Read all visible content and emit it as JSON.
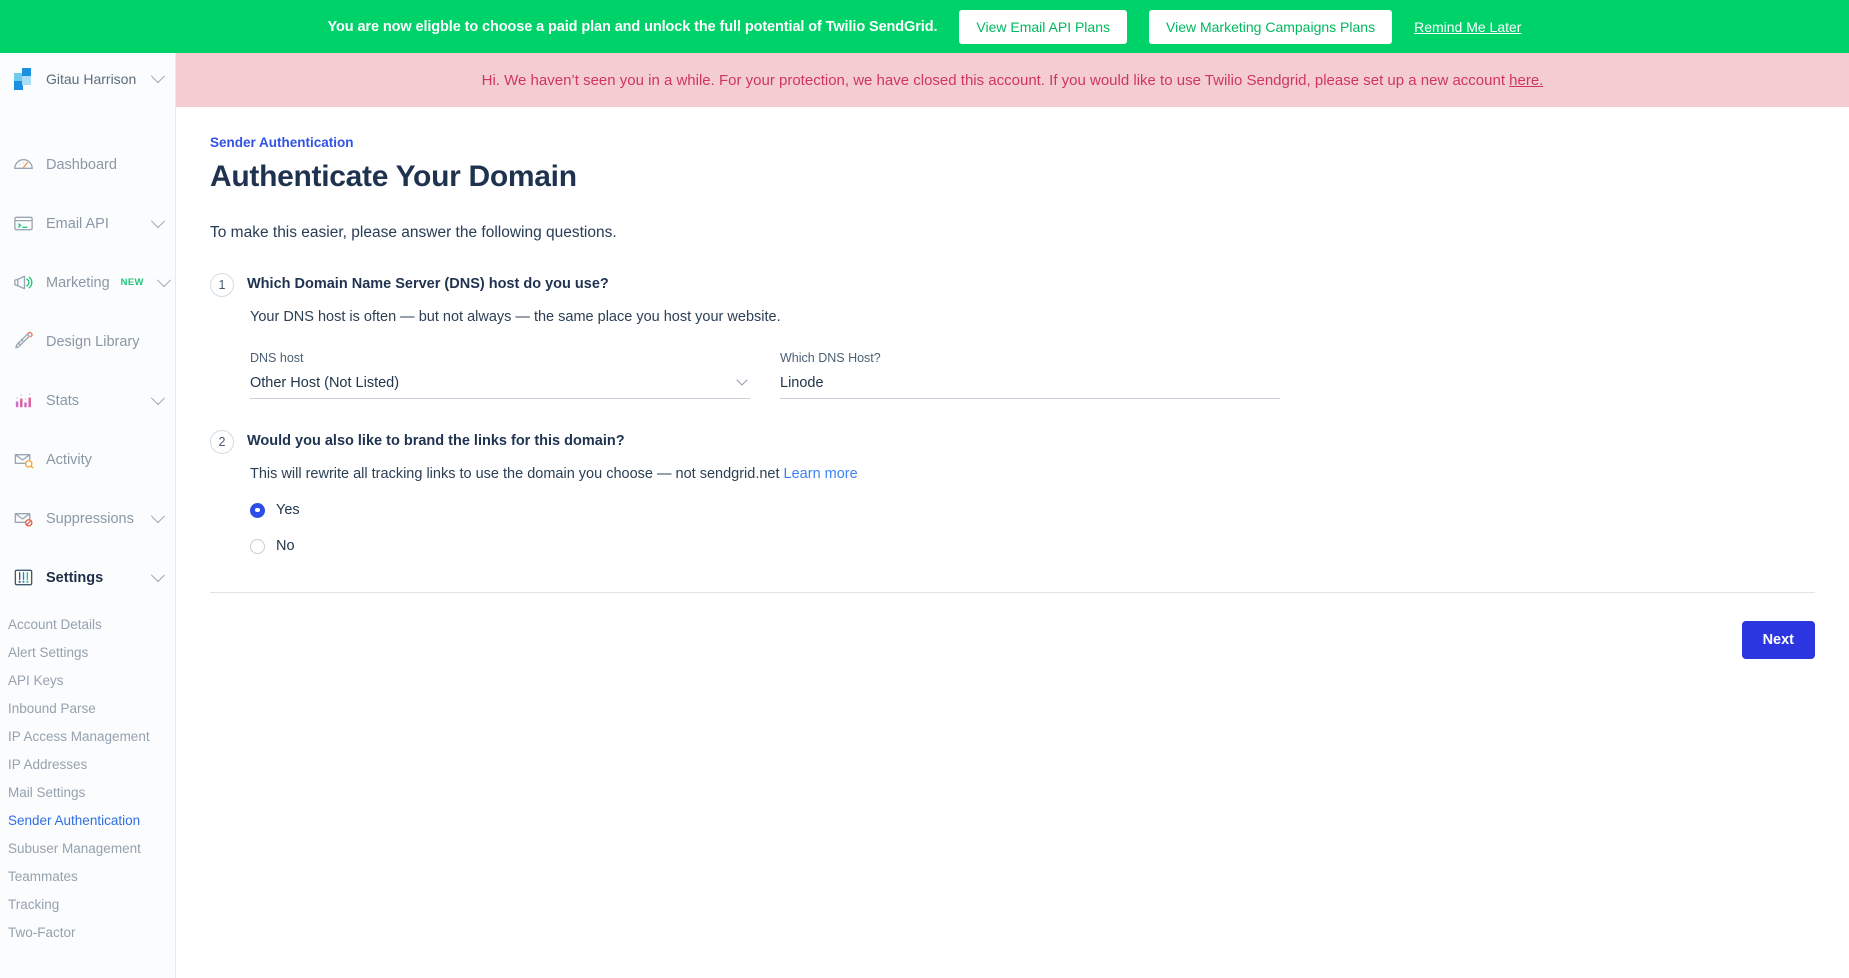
{
  "promo_banner": {
    "message": "You are now eligble to choose a paid plan and unlock the full potential of Twilio SendGrid.",
    "email_api_button": "View Email API Plans",
    "marketing_button": "View Marketing Campaigns Plans",
    "remind_link": "Remind Me Later",
    "background_color": "#00d26a"
  },
  "alert_banner": {
    "message_before": "Hi. We haven’t seen you in a while. For your protection, we have closed this account. If you would like to use Twilio Sendgrid, please set up a new account ",
    "link_text": "here.",
    "background_color": "#f4cdd2",
    "text_color": "#d0365c"
  },
  "sidebar": {
    "account_name": "Gitau Harrison",
    "account_caret_icon": "chevron-down-icon",
    "logo_icon": "sendgrid-logo-icon",
    "items": [
      {
        "label": "Dashboard",
        "icon": "gauge-icon",
        "has_caret": false,
        "badge": ""
      },
      {
        "label": "Email API",
        "icon": "code-window-icon",
        "has_caret": true,
        "badge": ""
      },
      {
        "label": "Marketing",
        "icon": "megaphone-icon",
        "has_caret": true,
        "badge": "NEW"
      },
      {
        "label": "Design Library",
        "icon": "pencil-ruler-icon",
        "has_caret": false,
        "badge": ""
      },
      {
        "label": "Stats",
        "icon": "bar-chart-icon",
        "has_caret": true,
        "badge": ""
      },
      {
        "label": "Activity",
        "icon": "envelope-search-icon",
        "has_caret": false,
        "badge": ""
      },
      {
        "label": "Suppressions",
        "icon": "envelope-block-icon",
        "has_caret": true,
        "badge": ""
      },
      {
        "label": "Settings",
        "icon": "sliders-icon",
        "has_caret": true,
        "badge": "",
        "active": true
      }
    ],
    "settings_submenu": [
      {
        "label": "Account Details",
        "selected": false
      },
      {
        "label": "Alert Settings",
        "selected": false
      },
      {
        "label": "API Keys",
        "selected": false
      },
      {
        "label": "Inbound Parse",
        "selected": false
      },
      {
        "label": "IP Access Management",
        "selected": false
      },
      {
        "label": "IP Addresses",
        "selected": false
      },
      {
        "label": "Mail Settings",
        "selected": false
      },
      {
        "label": "Sender Authentication",
        "selected": true
      },
      {
        "label": "Subuser Management",
        "selected": false
      },
      {
        "label": "Teammates",
        "selected": false
      },
      {
        "label": "Tracking",
        "selected": false
      },
      {
        "label": "Two-Factor",
        "selected": false
      }
    ],
    "selected_color": "#2f6fe4"
  },
  "main": {
    "breadcrumb": "Sender Authentication",
    "page_title": "Authenticate Your Domain",
    "subtitle": "To make this easier, please answer the following questions.",
    "question1": {
      "number": "1",
      "title": "Which Domain Name Server (DNS) host do you use?",
      "description": "Your DNS host is often — but not always — the same place you host your website.",
      "dns_host_label": "DNS host",
      "dns_host_value": "Other Host (Not Listed)",
      "which_host_label": "Which DNS Host?",
      "which_host_value": "Linode",
      "which_host_placeholder": "Which DNS Host?",
      "caret_icon": "chevron-down-icon"
    },
    "question2": {
      "number": "2",
      "title": "Would you also like to brand the links for this domain?",
      "description": "This will rewrite all tracking links to use the domain you choose — not sendgrid.net",
      "learn_more": "Learn more",
      "options": [
        {
          "label": "Yes",
          "checked": true
        },
        {
          "label": "No",
          "checked": false
        }
      ]
    },
    "next_button": "Next",
    "accent_color": "#2b35e0"
  }
}
